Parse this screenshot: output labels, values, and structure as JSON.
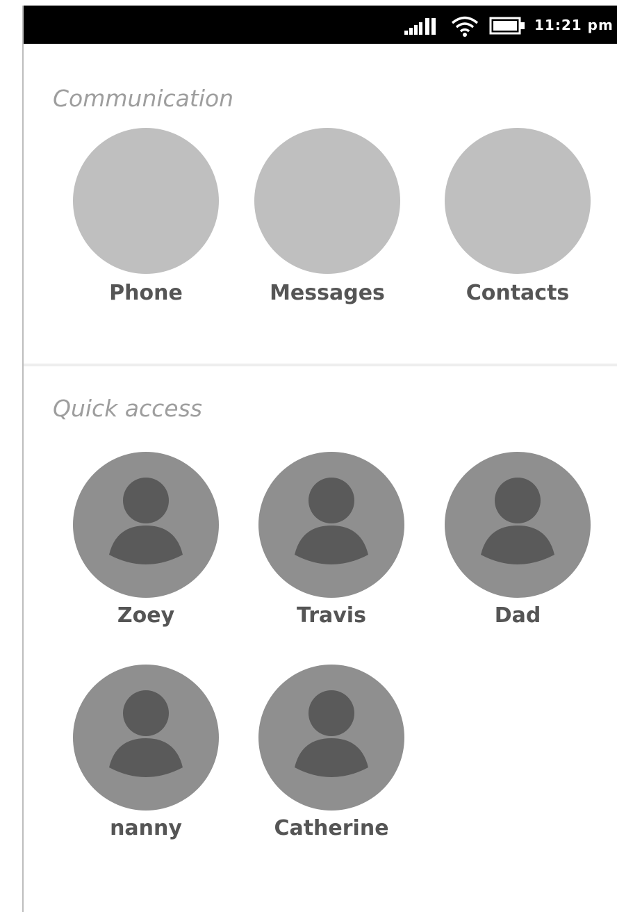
{
  "status_bar": {
    "time": "11:21 pm",
    "icons": [
      "signal-icon",
      "wifi-icon",
      "battery-icon"
    ]
  },
  "sections": [
    {
      "title": "Communication",
      "apps": [
        {
          "label": "Phone"
        },
        {
          "label": "Messages"
        },
        {
          "label": "Contacts"
        }
      ]
    },
    {
      "title": "Quick access",
      "contacts": [
        {
          "label": "Zoey"
        },
        {
          "label": "Travis"
        },
        {
          "label": "Dad"
        },
        {
          "label": "nanny"
        },
        {
          "label": "Catherine"
        }
      ]
    }
  ],
  "colors": {
    "app_placeholder": "#bfbfbf",
    "avatar_background": "#8f8f8f",
    "avatar_figure": "#5a5a5a",
    "section_title": "#9e9e9e",
    "label": "#555555"
  }
}
